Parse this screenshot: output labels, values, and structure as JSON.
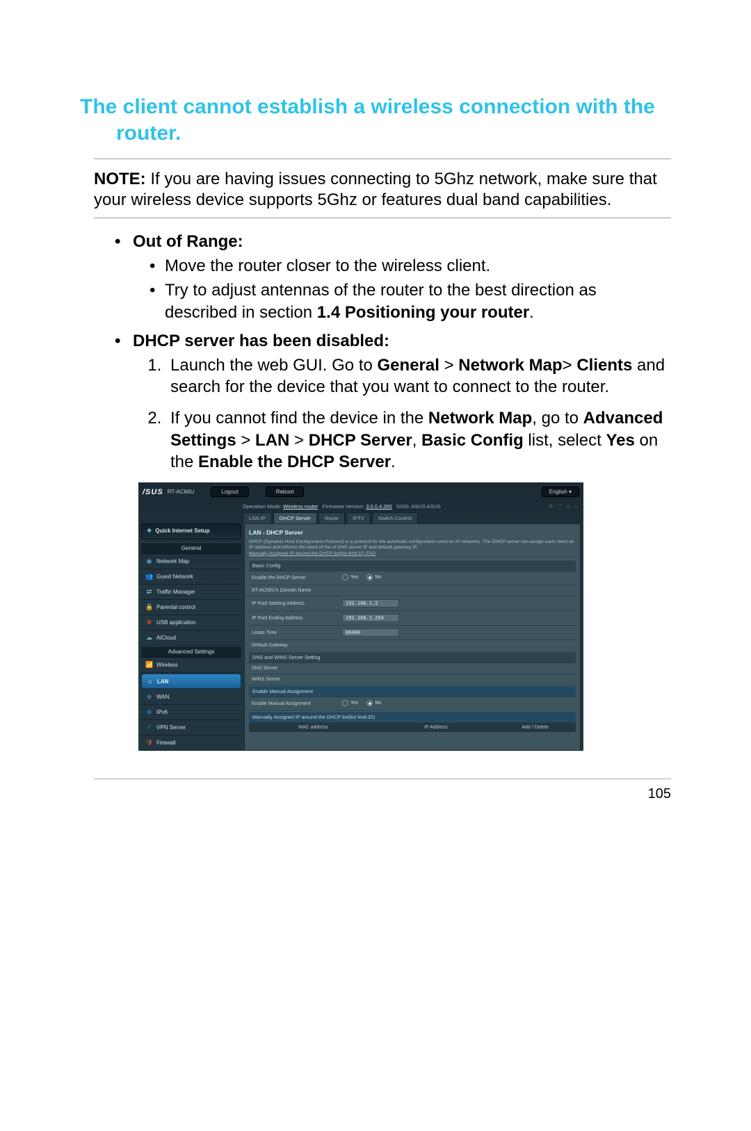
{
  "page": {
    "number": "105",
    "title_line1": "The client cannot establish a wireless connection with the",
    "title_line2": "router."
  },
  "note": {
    "label": "NOTE:",
    "text": " If you are having issues connecting to 5Ghz network, make sure that your wireless device supports 5Ghz or features dual band capabilities."
  },
  "section1": {
    "heading": "Out of Range:",
    "bullets": [
      "Move the router closer to the wireless client.",
      {
        "pre": "Try to adjust antennas of the router to the best direction as described in section ",
        "bold": "1.4 Positioning your router",
        "post": "."
      }
    ]
  },
  "section2": {
    "heading": "DHCP server has been disabled:",
    "step1": {
      "pre": "Launch the web GUI. Go to ",
      "b1": "General",
      "s1": " > ",
      "b2": "Network Map",
      "s2": "> ",
      "b3": "Clients",
      "post": " and search for the device that you want to connect to the router."
    },
    "step2": {
      "pre": "If you cannot find the device in the ",
      "b1": "Network Map",
      "s1": ", go to ",
      "b2": "Advanced Settings",
      "s2": " > ",
      "b3": "LAN",
      "s3": " > ",
      "b4": "DHCP Server",
      "s4": ", ",
      "b5": "Basic Config",
      "s5": " list, select ",
      "b6": "Yes",
      "s6": " on the ",
      "b7": "Enable the DHCP Server",
      "post": "."
    }
  },
  "router": {
    "brand": "/SUS",
    "model": "RT-AC66U",
    "logout": "Logout",
    "reboot": "Reboot",
    "language": "English",
    "status": {
      "mode_label": "Operation Mode:",
      "mode": "Wireless router",
      "fw_label": "Firmware Version:",
      "fw": "3.0.0.4.260",
      "ssid_label": "SSID:",
      "ssid": "ASUS ASUS"
    },
    "tabs": [
      "LAN IP",
      "DHCP Server",
      "Route",
      "IPTV",
      "Switch Control"
    ],
    "active_tab_index": 1,
    "qis": "Quick Internet Setup",
    "general_label": "General",
    "general_items": [
      "Network Map",
      "Guest Network",
      "Traffic Manager",
      "Parental control",
      "USB application",
      "AiCloud"
    ],
    "adv_label": "Advanced Settings",
    "adv_items": [
      "Wireless",
      "LAN",
      "WAN",
      "IPv6",
      "VPN Server",
      "Firewall"
    ],
    "adv_active_index": 1,
    "content": {
      "title": "LAN - DHCP Server",
      "desc1": "DHCP (Dynamic Host Configuration Protocol) is a protocol for the automatic configuration used on IP networks. The DHCP server can assign each client an IP address and informs the client of the of DNS server IP and default gateway IP.",
      "desc2": "Manually Assigned IP around the DHCP list(list limit:32) FAQ",
      "grp1": "Basic Config",
      "rows1": [
        {
          "label": "Enable the DHCP Server",
          "type": "radio",
          "yes": "Yes",
          "no": "No",
          "selected": "no"
        },
        {
          "label": "RT-AC66U's Domain Name",
          "type": "empty"
        },
        {
          "label": "IP Pool Starting Address",
          "type": "box",
          "value": "192.168.1.2"
        },
        {
          "label": "IP Pool Ending Address",
          "type": "box",
          "value": "192.168.1.254"
        },
        {
          "label": "Lease Time",
          "type": "box",
          "value": "86400"
        },
        {
          "label": "Default Gateway",
          "type": "empty"
        }
      ],
      "grp2": "DNS and WINS Server Setting",
      "rows2": [
        {
          "label": "DNS Server",
          "type": "empty"
        },
        {
          "label": "WINS Server",
          "type": "empty"
        }
      ],
      "grp3": "Enable Manual Assignment",
      "rows3": [
        {
          "label": "Enable Manual Assignment",
          "type": "radio",
          "yes": "Yes",
          "no": "No",
          "selected": "no"
        }
      ],
      "grp4": "Manually Assigned IP around the DHCP list(list limit:32)",
      "thead": [
        "MAC address",
        "IP Address",
        "Add / Delete"
      ]
    }
  }
}
